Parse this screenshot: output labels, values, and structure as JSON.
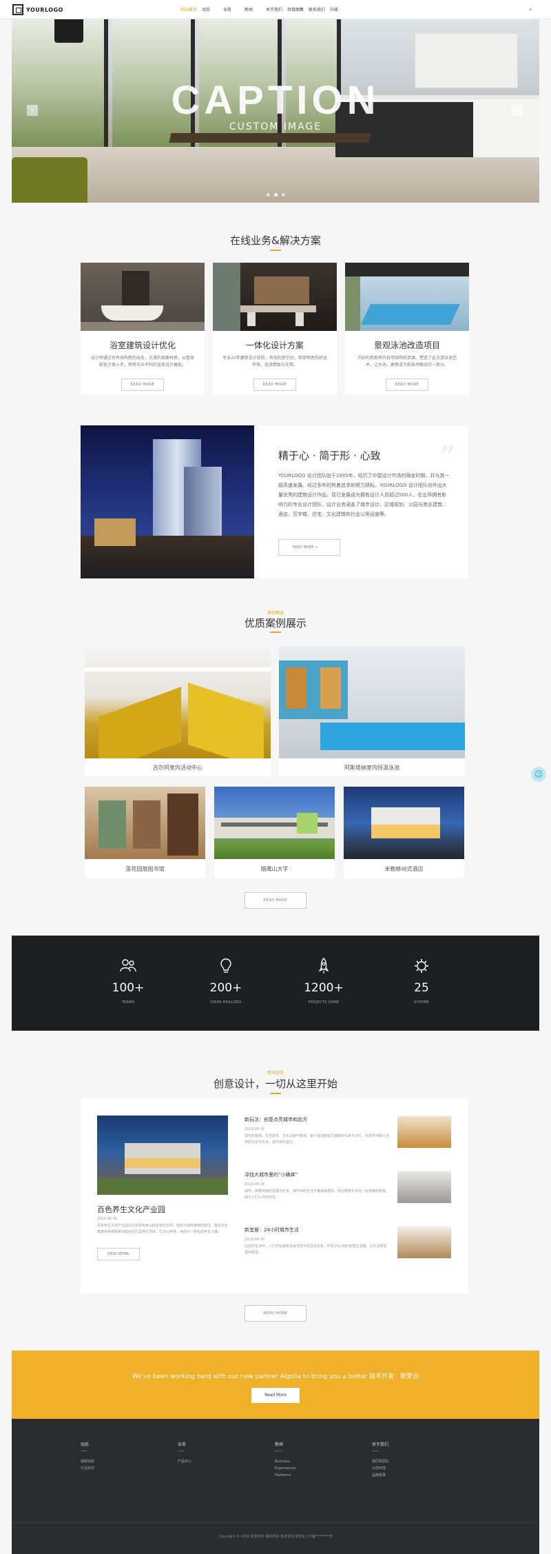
{
  "header": {
    "logo": "YOURLOGO",
    "nav": [
      "网站首页",
      "动态",
      "业务",
      "新闻",
      "关于我们",
      "项目图集",
      "联系我们",
      "升级"
    ],
    "active_index": 0
  },
  "hero": {
    "title": "CAPTION",
    "subtitle": "CUSTOM IMAGE",
    "prev": "‹",
    "next": "›"
  },
  "services": {
    "title": "在线业务&解决方案",
    "items": [
      {
        "title": "浴室建筑设计优化",
        "text": "设计师通过将有结构感的线条，光滑的表面材质，从整体配色方案入手，将秀与众不同的浴室设计展现。",
        "more": "READ MORE"
      },
      {
        "title": "一体化设计方案",
        "text": "专业20年建筑设计经验，有效利用空间，简单明亮的舒适环境，追求精致与实用。",
        "more": "READ MORE"
      },
      {
        "title": "景观泳池改造项目",
        "text": "巧妙利用现有的自然结构和资源，塑造了此次游泳池艺术，让水池，建筑成为和自然融合的一部分。",
        "more": "READ MORE"
      }
    ]
  },
  "about": {
    "title": "精于心 · 简于形 · 心致",
    "text": "YOURLOGO 设计团队始于1995年，经历了中国设计市场的萌金时期，并与其一路高速发展。经过多年的热着追求和努力耕耘，YOURLOGO 设计团队创作出大量优秀的建筑设计作品，现已发展成为拥有设计人员超过500人，在业界拥有影响力的专业设计团队。设计业务涵盖了城市设计、区域规划、公园与商业建筑、酒店、写字楼、住宅、文化建筑和社会公用设施等。",
    "more": "READ MORE"
  },
  "cases": {
    "label": "案例精选",
    "title": "优质案例展示",
    "items": [
      "古尔阿室内活动中心",
      "阿斯塔纳室内恒温泳池",
      "莲花园旅图书馆",
      "猎鹰山大学",
      "米勒移动式酒店"
    ],
    "more": "READ MORE"
  },
  "stats": [
    {
      "value": "100+",
      "label": "TEAMS",
      "icon": "team-icon"
    },
    {
      "value": "200+",
      "label": "IDEAS REALIZED",
      "icon": "lightbulb-icon"
    },
    {
      "value": "1200+",
      "label": "PROJECTS DONE",
      "icon": "rocket-icon"
    },
    {
      "value": "25",
      "label": "SYSTEM",
      "icon": "gear-icon"
    }
  ],
  "news": {
    "label": "新闻动态",
    "title": "创意设计，一切从这里开始",
    "featured": {
      "title": "百色养生文化产业园",
      "date": "2019-06-16",
      "text": "百色养生文化产业园以打造百色养山田水色的空间，规划为城际独特的居住，融合文化健康休养度假等功能的社区型养生项目，打造以养老、休闲为一体化的养生小镇。",
      "button": "VIEW DETAIL"
    },
    "items": [
      {
        "title": "新玩法：创意点亮城市和远方",
        "date": "2019-06-16",
        "text": "现代的景观、生态城市、文化设施与景观，每个城市都有它独特的元素与记忆，在城市中融入当地的文化与艺术，提升城市品位。"
      },
      {
        "title": "寻找大城市里的“小确幸”",
        "date": "2019-06-16",
        "text": "城市，随着快速的发展与扩张，城市中的生活节奏越来越快，而在喧嚣中寻找一处安静的角落，成为人们心中的向往。"
      },
      {
        "title": "新宜居：24小时城市生活",
        "date": "2019-06-16",
        "text": "在城市生活中，人们开始重新思考住宅与社区的关系，打造24小时的宜居生活圈，让生活更加便利舒适。"
      }
    ],
    "more": "READ MORE"
  },
  "cta": {
    "text": "We've been working hard with our new partner Algolia to bring you a better 技术开发：新梦云",
    "button": "Read More"
  },
  "footer": {
    "columns": [
      {
        "title": "动态",
        "links": [
          "最新动态",
          "行业资讯"
        ]
      },
      {
        "title": "业务",
        "links": [
          "产品中心"
        ]
      },
      {
        "title": "新闻",
        "links": [
          "Business",
          "Experiences",
          "Platforms"
        ]
      },
      {
        "title": "关于我们",
        "links": [
          "我们的团队",
          "公司环境",
          "品牌故事"
        ]
      }
    ],
    "copyright": "Copyright © 2020 新梦科技 版权所有 技术支持 新梦云 ICP备********号"
  },
  "colors": {
    "accent": "#f0b02a",
    "dark": "#1d1f22",
    "footer": "#2a2c30"
  }
}
